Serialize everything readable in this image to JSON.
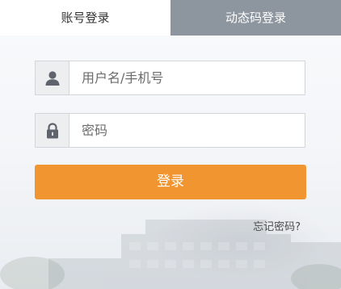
{
  "tabs": {
    "account_login": "账号登录",
    "dynamic_code_login": "动态码登录"
  },
  "form": {
    "username_placeholder": "用户名/手机号",
    "username_value": "",
    "password_placeholder": "密码",
    "password_value": "",
    "username_icon": "user-icon",
    "password_icon": "lock-icon"
  },
  "buttons": {
    "login_label": "登录"
  },
  "links": {
    "forgot_password": "忘记密码?"
  },
  "colors": {
    "accent": "#f0952f",
    "inactive_tab": "#8d969f",
    "icon": "#5f646c"
  }
}
